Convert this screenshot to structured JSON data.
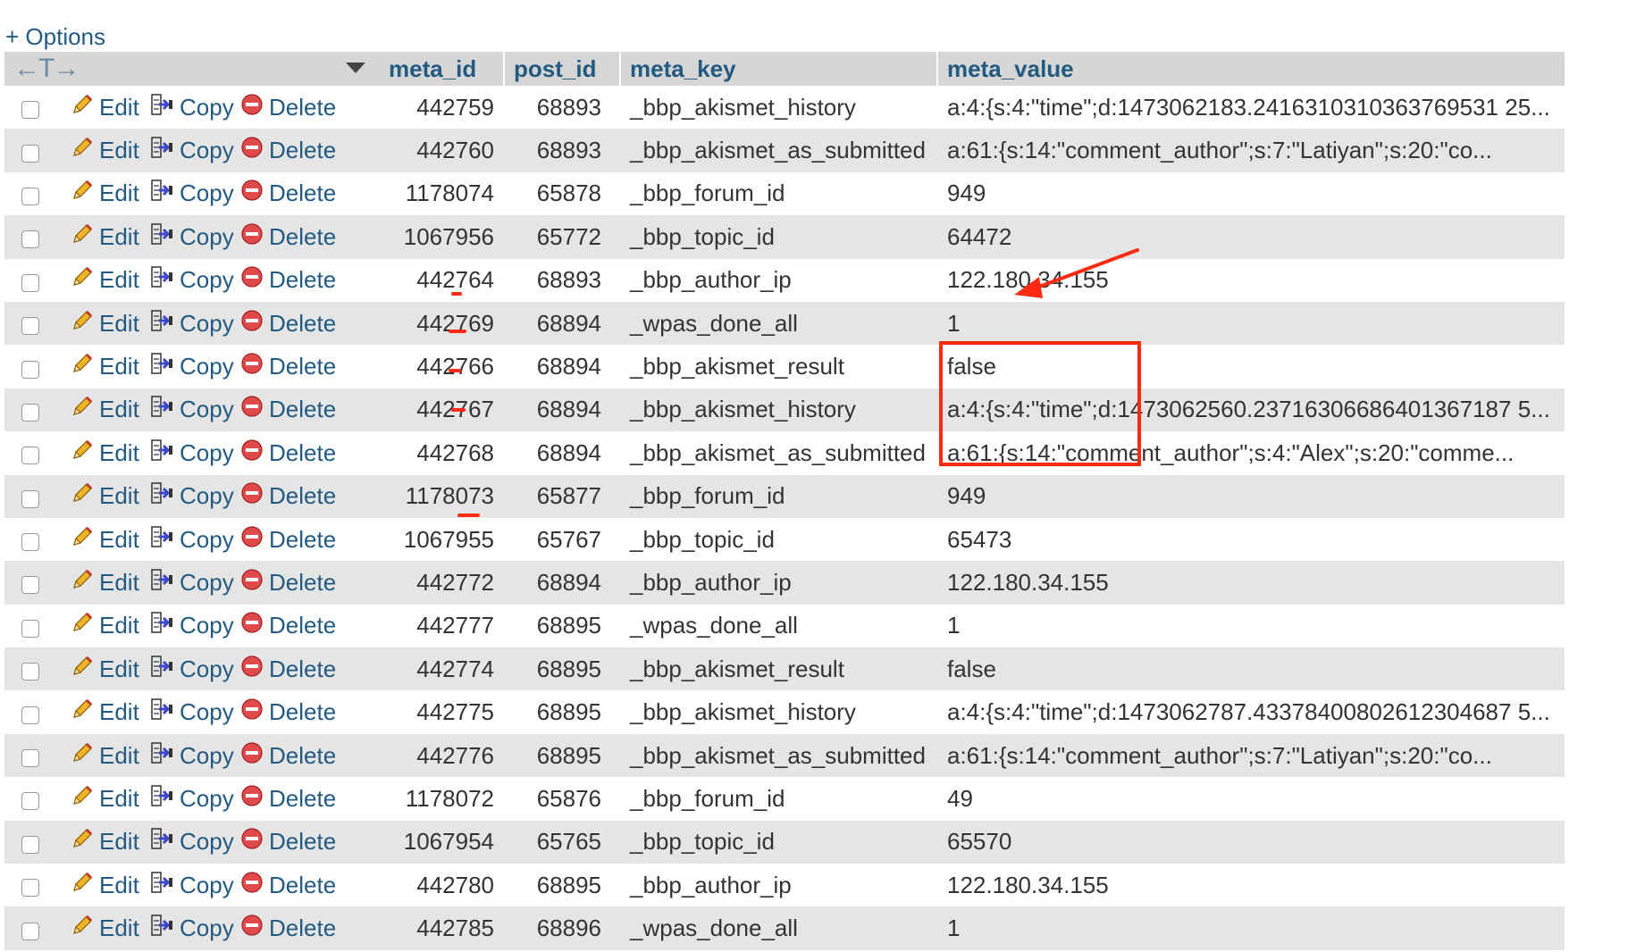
{
  "options_label": "+ Options",
  "header": {
    "arrows_label": "←T→",
    "columns": [
      "meta_id",
      "post_id",
      "meta_key",
      "meta_value"
    ]
  },
  "action_labels": {
    "edit": "Edit",
    "copy": "Copy",
    "delete": "Delete"
  },
  "icons": {
    "edit": "pencil-icon",
    "copy": "copy-row-icon",
    "delete": "delete-circle-icon"
  },
  "colors": {
    "link": "#235a81",
    "header_bg": "#d6d6d6",
    "row_alt_bg": "#e5e5e5",
    "annotation": "#ff2a12"
  },
  "rows": [
    {
      "meta_id": "442759",
      "post_id": "68893",
      "meta_key": "_bbp_akismet_history",
      "meta_value": "a:4:{s:4:\"time\";d:1473062183.2416310310363769531 25..."
    },
    {
      "meta_id": "442760",
      "post_id": "68893",
      "meta_key": "_bbp_akismet_as_submitted",
      "meta_value": "a:61:{s:14:\"comment_author\";s:7:\"Latiyan\";s:20:\"co..."
    },
    {
      "meta_id": "1178074",
      "post_id": "65878",
      "meta_key": "_bbp_forum_id",
      "meta_value": "949"
    },
    {
      "meta_id": "1067956",
      "post_id": "65772",
      "meta_key": "_bbp_topic_id",
      "meta_value": "64472"
    },
    {
      "meta_id": "442764",
      "post_id": "68893",
      "meta_key": "_bbp_author_ip",
      "meta_value": "122.180.34.155"
    },
    {
      "meta_id": "442769",
      "post_id": "68894",
      "meta_key": "_wpas_done_all",
      "meta_value": "1"
    },
    {
      "meta_id": "442766",
      "post_id": "68894",
      "meta_key": "_bbp_akismet_result",
      "meta_value": "false"
    },
    {
      "meta_id": "442767",
      "post_id": "68894",
      "meta_key": "_bbp_akismet_history",
      "meta_value": "a:4:{s:4:\"time\";d:1473062560.23716306686401367187 5..."
    },
    {
      "meta_id": "442768",
      "post_id": "68894",
      "meta_key": "_bbp_akismet_as_submitted",
      "meta_value": "a:61:{s:14:\"comment_author\";s:4:\"Alex\";s:20:\"comme..."
    },
    {
      "meta_id": "1178073",
      "post_id": "65877",
      "meta_key": "_bbp_forum_id",
      "meta_value": "949"
    },
    {
      "meta_id": "1067955",
      "post_id": "65767",
      "meta_key": "_bbp_topic_id",
      "meta_value": "65473"
    },
    {
      "meta_id": "442772",
      "post_id": "68894",
      "meta_key": "_bbp_author_ip",
      "meta_value": "122.180.34.155"
    },
    {
      "meta_id": "442777",
      "post_id": "68895",
      "meta_key": "_wpas_done_all",
      "meta_value": "1"
    },
    {
      "meta_id": "442774",
      "post_id": "68895",
      "meta_key": "_bbp_akismet_result",
      "meta_value": "false"
    },
    {
      "meta_id": "442775",
      "post_id": "68895",
      "meta_key": "_bbp_akismet_history",
      "meta_value": "a:4:{s:4:\"time\";d:1473062787.43378400802612304687 5..."
    },
    {
      "meta_id": "442776",
      "post_id": "68895",
      "meta_key": "_bbp_akismet_as_submitted",
      "meta_value": "a:61:{s:14:\"comment_author\";s:7:\"Latiyan\";s:20:\"co..."
    },
    {
      "meta_id": "1178072",
      "post_id": "65876",
      "meta_key": "_bbp_forum_id",
      "meta_value": "49"
    },
    {
      "meta_id": "1067954",
      "post_id": "65765",
      "meta_key": "_bbp_topic_id",
      "meta_value": "65570"
    },
    {
      "meta_id": "442780",
      "post_id": "68895",
      "meta_key": "_bbp_author_ip",
      "meta_value": "122.180.34.155"
    },
    {
      "meta_id": "442785",
      "post_id": "68896",
      "meta_key": "_wpas_done_all",
      "meta_value": "1"
    }
  ]
}
